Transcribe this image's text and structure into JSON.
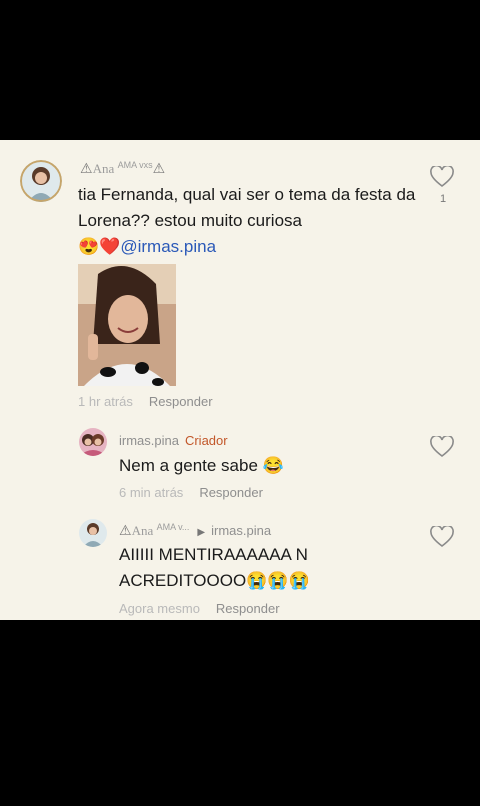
{
  "comments": [
    {
      "username_main": "Ana",
      "username_sup": "AMA vxs",
      "text": "tia Fernanda, qual vai ser o tema da festa da Lorena?? estou muito curiosa",
      "emojis": "😍❤️",
      "mention": "@irmas.pina",
      "time": "1 hr atrás",
      "reply_label": "Responder",
      "like_count": "1"
    },
    {
      "username": "irmas.pina",
      "badge": "Criador",
      "text": "Nem a gente sabe 😂",
      "time": "6 min atrás",
      "reply_label": "Responder"
    },
    {
      "username_main": "Ana",
      "username_sup": "AMA v...",
      "reply_to": "irmas.pina",
      "text_line1": "AIIIII MENTIRAAAAAA N",
      "text_line2": "ACREDITOOOO😭😭😭",
      "time": "Agora mesmo",
      "reply_label": "Responder"
    }
  ],
  "icons": {
    "like": "heart-outline-icon",
    "reply_arrow": "triangle-right-icon",
    "name_decoration": "triangle-icon"
  },
  "colors": {
    "panel_bg": "#f6f3e9",
    "mention": "#2b59b8",
    "creator_badge": "#c2572a"
  }
}
